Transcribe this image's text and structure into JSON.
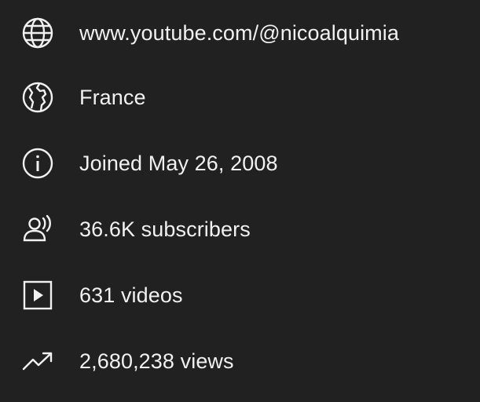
{
  "about": {
    "link": {
      "icon": "globe-icon",
      "text": "www.youtube.com/@nicoalquimia"
    },
    "country": {
      "icon": "earth-icon",
      "text": "France"
    },
    "joined": {
      "icon": "info-icon",
      "text": "Joined May 26, 2008"
    },
    "subscribers": {
      "icon": "subscribers-icon",
      "text": "36.6K subscribers"
    },
    "videos": {
      "icon": "video-icon",
      "text": "631 videos"
    },
    "views": {
      "icon": "trending-up-icon",
      "text": "2,680,238 views"
    }
  },
  "colors": {
    "background": "#212121",
    "text": "#f1f1f1"
  }
}
